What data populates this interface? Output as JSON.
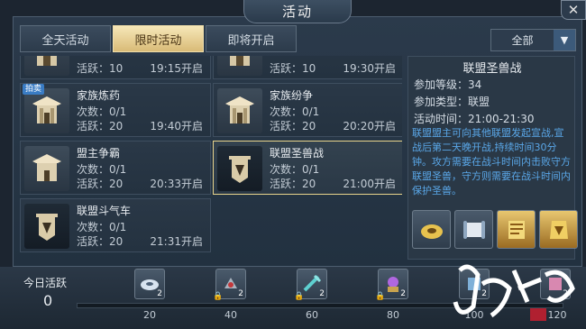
{
  "window": {
    "title": "活动",
    "close": "✕"
  },
  "tabs": [
    {
      "label": "全天活动"
    },
    {
      "label": "限时活动"
    },
    {
      "label": "即将开启"
    }
  ],
  "filter": {
    "value": "全部"
  },
  "activities": [
    {
      "name": "",
      "count": "",
      "active": "活跃：10",
      "time": "19:15开启"
    },
    {
      "name": "",
      "count": "",
      "active": "活跃：10",
      "time": "19:30开启"
    },
    {
      "name": "家族炼药",
      "count": "次数：0/1",
      "active": "活跃：20",
      "time": "19:40开启",
      "badge": "拍卖"
    },
    {
      "name": "家族纷争",
      "count": "次数：0/1",
      "active": "活跃：20",
      "time": "20:20开启"
    },
    {
      "name": "盟主争霸",
      "count": "次数：0/1",
      "active": "活跃：20",
      "time": "20:33开启"
    },
    {
      "name": "联盟圣兽战",
      "count": "次数：0/1",
      "active": "活跃：20",
      "time": "21:00开启"
    },
    {
      "name": "联盟斗气车",
      "count": "次数：0/1",
      "active": "活跃：20",
      "time": "21:31开启"
    }
  ],
  "detail": {
    "name": "联盟圣兽战",
    "level": "参加等级：34",
    "type": "参加类型：联盟",
    "time": "活动时间：21:00-21:30",
    "description": "联盟盟主可向其他联盟发起宣战,宣战后第二天晚开战,持续时间30分钟。攻方需要在战斗时间内击败守方联盟圣兽，守方则需要在战斗时间内保护圣兽。"
  },
  "bottom": {
    "today_label": "今日活跃",
    "today_value": "0",
    "milestones": [
      {
        "value": "20",
        "count": "2"
      },
      {
        "value": "40",
        "count": "2"
      },
      {
        "value": "60",
        "count": "2"
      },
      {
        "value": "80",
        "count": "2"
      },
      {
        "value": "100",
        "count": "2"
      },
      {
        "value": "120",
        "count": "2"
      }
    ]
  },
  "colors": {
    "accent": "#e8d48c",
    "tab_active": "#e6cf8f",
    "desc_text": "#5aa7e8"
  }
}
